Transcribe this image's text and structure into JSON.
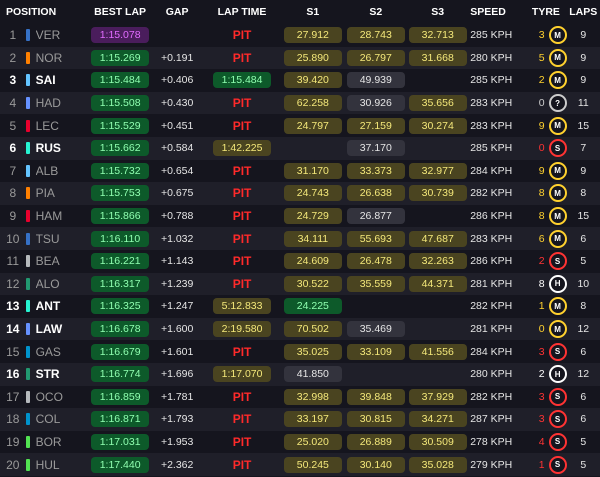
{
  "headers": {
    "position": "POSITION",
    "best_lap": "BEST LAP",
    "gap": "GAP",
    "lap_time": "LAP TIME",
    "s1": "S1",
    "s2": "S2",
    "s3": "S3",
    "speed": "SPEED",
    "tyre": "TYRE",
    "laps": "LAPS"
  },
  "colors": {
    "purple_time": "#e16cff",
    "green_time": "#8fffb0",
    "yellow_time": "#f4e87a",
    "pit": "#ff2a2a",
    "medium": "#ffd12e",
    "soft": "#ff3333",
    "hard": "#ffffff",
    "intermediate": "#cccccc"
  },
  "rows": [
    {
      "pos": "1",
      "driver": "VER",
      "team": "#3671c6",
      "out": false,
      "best": "1:15.078",
      "best_style": "purple",
      "gap": "",
      "lap": "PIT",
      "lap_style": "pit",
      "s1": "27.912",
      "s1_style": "yellow",
      "s2": "28.743",
      "s2_style": "yellow",
      "s3": "32.713",
      "s3_style": "yellow",
      "speed": "285 KPH",
      "age": "3",
      "tyre": "M",
      "tyre_color": "#ffd12e",
      "laps": "9"
    },
    {
      "pos": "2",
      "driver": "NOR",
      "team": "#ff8000",
      "out": false,
      "best": "1:15.269",
      "best_style": "green",
      "gap": "+0.191",
      "lap": "PIT",
      "lap_style": "pit",
      "s1": "25.890",
      "s1_style": "yellow",
      "s2": "26.797",
      "s2_style": "yellow",
      "s3": "31.668",
      "s3_style": "yellow",
      "speed": "280 KPH",
      "age": "5",
      "tyre": "M",
      "tyre_color": "#ffd12e",
      "laps": "9"
    },
    {
      "pos": "3",
      "driver": "SAI",
      "team": "#64c4ff",
      "out": true,
      "best": "1:15.484",
      "best_style": "green",
      "gap": "+0.406",
      "lap": "1:15.484",
      "lap_style": "green",
      "s1": "39.420",
      "s1_style": "yellow",
      "s2": "49.939",
      "s2_style": "grey",
      "s3": "",
      "s3_style": "empty",
      "speed": "285 KPH",
      "age": "2",
      "tyre": "M",
      "tyre_color": "#ffd12e",
      "laps": "9"
    },
    {
      "pos": "4",
      "driver": "HAD",
      "team": "#6692ff",
      "out": false,
      "best": "1:15.508",
      "best_style": "green",
      "gap": "+0.430",
      "lap": "PIT",
      "lap_style": "pit",
      "s1": "62.258",
      "s1_style": "yellow",
      "s2": "30.926",
      "s2_style": "grey",
      "s3": "35.656",
      "s3_style": "yellow",
      "speed": "283 KPH",
      "age": "0",
      "tyre": "?",
      "tyre_color": "#cccccc",
      "laps": "11"
    },
    {
      "pos": "5",
      "driver": "LEC",
      "team": "#e8002d",
      "out": false,
      "best": "1:15.529",
      "best_style": "green",
      "gap": "+0.451",
      "lap": "PIT",
      "lap_style": "pit",
      "s1": "24.797",
      "s1_style": "yellow",
      "s2": "27.159",
      "s2_style": "yellow",
      "s3": "30.274",
      "s3_style": "yellow",
      "speed": "283 KPH",
      "age": "9",
      "tyre": "M",
      "tyre_color": "#ffd12e",
      "laps": "15"
    },
    {
      "pos": "6",
      "driver": "RUS",
      "team": "#27f4d2",
      "out": true,
      "best": "1:15.662",
      "best_style": "green",
      "gap": "+0.584",
      "lap": "1:42.225",
      "lap_style": "yellow",
      "s1": "",
      "s1_style": "empty",
      "s2": "37.170",
      "s2_style": "grey",
      "s3": "",
      "s3_style": "empty",
      "speed": "285 KPH",
      "age": "0",
      "tyre": "S",
      "tyre_color": "#ff3333",
      "laps": "7"
    },
    {
      "pos": "7",
      "driver": "ALB",
      "team": "#64c4ff",
      "out": false,
      "best": "1:15.732",
      "best_style": "green",
      "gap": "+0.654",
      "lap": "PIT",
      "lap_style": "pit",
      "s1": "31.170",
      "s1_style": "yellow",
      "s2": "33.373",
      "s2_style": "yellow",
      "s3": "32.977",
      "s3_style": "yellow",
      "speed": "284 KPH",
      "age": "9",
      "tyre": "M",
      "tyre_color": "#ffd12e",
      "laps": "9"
    },
    {
      "pos": "8",
      "driver": "PIA",
      "team": "#ff8000",
      "out": false,
      "best": "1:15.753",
      "best_style": "green",
      "gap": "+0.675",
      "lap": "PIT",
      "lap_style": "pit",
      "s1": "24.743",
      "s1_style": "yellow",
      "s2": "26.638",
      "s2_style": "yellow",
      "s3": "30.739",
      "s3_style": "yellow",
      "speed": "282 KPH",
      "age": "8",
      "tyre": "M",
      "tyre_color": "#ffd12e",
      "laps": "8"
    },
    {
      "pos": "9",
      "driver": "HAM",
      "team": "#e8002d",
      "out": false,
      "best": "1:15.866",
      "best_style": "green",
      "gap": "+0.788",
      "lap": "PIT",
      "lap_style": "pit",
      "s1": "24.729",
      "s1_style": "yellow",
      "s2": "26.877",
      "s2_style": "grey",
      "s3": "",
      "s3_style": "empty",
      "speed": "286 KPH",
      "age": "8",
      "tyre": "M",
      "tyre_color": "#ffd12e",
      "laps": "15"
    },
    {
      "pos": "10",
      "driver": "TSU",
      "team": "#3671c6",
      "out": false,
      "best": "1:16.110",
      "best_style": "green",
      "gap": "+1.032",
      "lap": "PIT",
      "lap_style": "pit",
      "s1": "34.111",
      "s1_style": "yellow",
      "s2": "55.693",
      "s2_style": "yellow",
      "s3": "47.687",
      "s3_style": "yellow",
      "speed": "283 KPH",
      "age": "6",
      "tyre": "M",
      "tyre_color": "#ffd12e",
      "laps": "6"
    },
    {
      "pos": "11",
      "driver": "BEA",
      "team": "#b6babd",
      "out": false,
      "best": "1:16.221",
      "best_style": "green",
      "gap": "+1.143",
      "lap": "PIT",
      "lap_style": "pit",
      "s1": "24.609",
      "s1_style": "yellow",
      "s2": "26.478",
      "s2_style": "yellow",
      "s3": "32.263",
      "s3_style": "yellow",
      "speed": "286 KPH",
      "age": "2",
      "tyre": "S",
      "tyre_color": "#ff3333",
      "laps": "5"
    },
    {
      "pos": "12",
      "driver": "ALO",
      "team": "#229971",
      "out": false,
      "best": "1:16.317",
      "best_style": "green",
      "gap": "+1.239",
      "lap": "PIT",
      "lap_style": "pit",
      "s1": "30.522",
      "s1_style": "yellow",
      "s2": "35.559",
      "s2_style": "yellow",
      "s3": "44.371",
      "s3_style": "yellow",
      "speed": "281 KPH",
      "age": "8",
      "tyre": "H",
      "tyre_color": "#ffffff",
      "laps": "10"
    },
    {
      "pos": "13",
      "driver": "ANT",
      "team": "#27f4d2",
      "out": true,
      "best": "1:16.325",
      "best_style": "green",
      "gap": "+1.247",
      "lap": "5:12.833",
      "lap_style": "yellow",
      "s1": "24.225",
      "s1_style": "green",
      "s2": "",
      "s2_style": "empty",
      "s3": "",
      "s3_style": "empty",
      "speed": "282 KPH",
      "age": "1",
      "tyre": "M",
      "tyre_color": "#ffd12e",
      "laps": "8"
    },
    {
      "pos": "14",
      "driver": "LAW",
      "team": "#6692ff",
      "out": true,
      "best": "1:16.678",
      "best_style": "green",
      "gap": "+1.600",
      "lap": "2:19.580",
      "lap_style": "yellow",
      "s1": "70.502",
      "s1_style": "yellow",
      "s2": "35.469",
      "s2_style": "grey",
      "s3": "",
      "s3_style": "empty",
      "speed": "281 KPH",
      "age": "0",
      "tyre": "M",
      "tyre_color": "#ffd12e",
      "laps": "12"
    },
    {
      "pos": "15",
      "driver": "GAS",
      "team": "#0093cc",
      "out": false,
      "best": "1:16.679",
      "best_style": "green",
      "gap": "+1.601",
      "lap": "PIT",
      "lap_style": "pit",
      "s1": "35.025",
      "s1_style": "yellow",
      "s2": "33.109",
      "s2_style": "yellow",
      "s3": "41.556",
      "s3_style": "yellow",
      "speed": "284 KPH",
      "age": "3",
      "tyre": "S",
      "tyre_color": "#ff3333",
      "laps": "6"
    },
    {
      "pos": "16",
      "driver": "STR",
      "team": "#229971",
      "out": true,
      "best": "1:16.774",
      "best_style": "green",
      "gap": "+1.696",
      "lap": "1:17.070",
      "lap_style": "yellow",
      "s1": "41.850",
      "s1_style": "grey",
      "s2": "",
      "s2_style": "empty",
      "s3": "",
      "s3_style": "empty",
      "speed": "280 KPH",
      "age": "2",
      "tyre": "H",
      "tyre_color": "#ffffff",
      "laps": "12"
    },
    {
      "pos": "17",
      "driver": "OCO",
      "team": "#b6babd",
      "out": false,
      "best": "1:16.859",
      "best_style": "green",
      "gap": "+1.781",
      "lap": "PIT",
      "lap_style": "pit",
      "s1": "32.998",
      "s1_style": "yellow",
      "s2": "39.848",
      "s2_style": "yellow",
      "s3": "37.929",
      "s3_style": "yellow",
      "speed": "282 KPH",
      "age": "3",
      "tyre": "S",
      "tyre_color": "#ff3333",
      "laps": "6"
    },
    {
      "pos": "18",
      "driver": "COL",
      "team": "#0093cc",
      "out": false,
      "best": "1:16.871",
      "best_style": "green",
      "gap": "+1.793",
      "lap": "PIT",
      "lap_style": "pit",
      "s1": "33.197",
      "s1_style": "yellow",
      "s2": "30.815",
      "s2_style": "yellow",
      "s3": "34.271",
      "s3_style": "yellow",
      "speed": "287 KPH",
      "age": "3",
      "tyre": "S",
      "tyre_color": "#ff3333",
      "laps": "6"
    },
    {
      "pos": "19",
      "driver": "BOR",
      "team": "#52e252",
      "out": false,
      "best": "1:17.031",
      "best_style": "green",
      "gap": "+1.953",
      "lap": "PIT",
      "lap_style": "pit",
      "s1": "25.020",
      "s1_style": "yellow",
      "s2": "26.889",
      "s2_style": "yellow",
      "s3": "30.509",
      "s3_style": "yellow",
      "speed": "278 KPH",
      "age": "4",
      "tyre": "S",
      "tyre_color": "#ff3333",
      "laps": "5"
    },
    {
      "pos": "20",
      "driver": "HUL",
      "team": "#52e252",
      "out": false,
      "best": "1:17.440",
      "best_style": "green",
      "gap": "+2.362",
      "lap": "PIT",
      "lap_style": "pit",
      "s1": "50.245",
      "s1_style": "yellow",
      "s2": "30.140",
      "s2_style": "yellow",
      "s3": "35.028",
      "s3_style": "yellow",
      "speed": "279 KPH",
      "age": "1",
      "tyre": "S",
      "tyre_color": "#ff3333",
      "laps": "5"
    }
  ]
}
